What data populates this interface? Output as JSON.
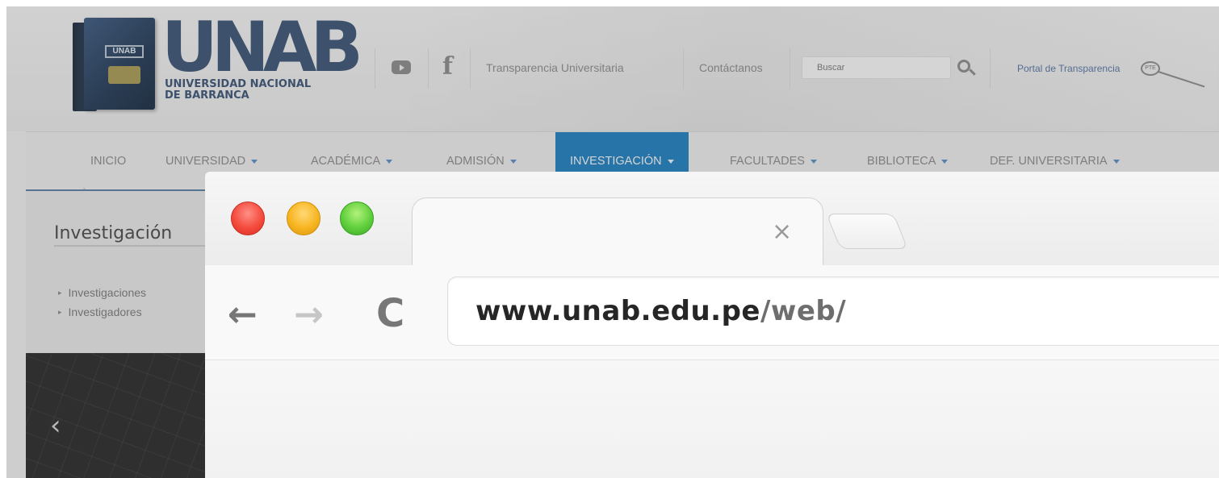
{
  "site": {
    "logo": {
      "wordmark": "UNAB",
      "emblem": "UNAB",
      "name_line1": "UNIVERSIDAD NACIONAL",
      "name_line2": "DE BARRANCA"
    },
    "topbar": {
      "youtube_icon": "youtube-icon",
      "facebook_icon": "facebook-icon",
      "transparencia": "Transparencia Universitaria",
      "contactanos": "Contáctanos",
      "search_placeholder": "Buscar",
      "portal": "Portal de Transparencia",
      "portal_badge": "PTE"
    },
    "nav": [
      {
        "label": "INICIO"
      },
      {
        "label": "UNIVERSIDAD"
      },
      {
        "label": "ACADÉMICA"
      },
      {
        "label": "ADMISIÓN"
      },
      {
        "label": "INVESTIGACIÓN",
        "active": true
      },
      {
        "label": "FACULTADES"
      },
      {
        "label": "BIBLIOTECA"
      },
      {
        "label": "DEF. UNIVERSITARIA"
      }
    ],
    "sidebar": {
      "title": "Investigación",
      "links": [
        "Investigaciones",
        "Investigadores"
      ]
    },
    "banner_prev": "‹"
  },
  "browser": {
    "tab_close": "×",
    "back": "←",
    "forward": "→",
    "reload": "C",
    "url_domain": "www.unab.edu.pe",
    "url_path": "/web/"
  },
  "colors": {
    "nav_active": "#1f7ebe",
    "logo_blue": "#3b5475",
    "traffic_red": "#f44b3c",
    "traffic_yellow": "#f7b520",
    "traffic_green": "#5fcf3c"
  }
}
